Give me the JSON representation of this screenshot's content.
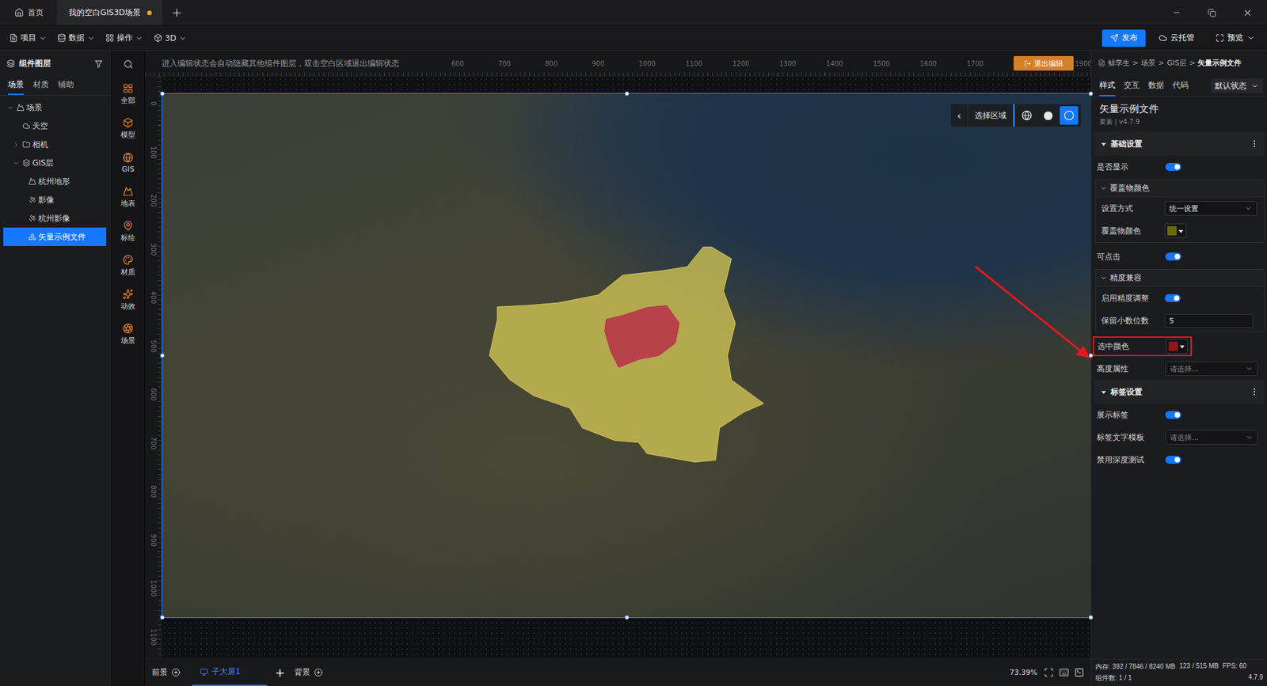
{
  "title_bar": {
    "home": "首页",
    "tabs": [
      {
        "label": "我的空白GIS3D场景",
        "selected": true,
        "unsaved": true
      }
    ],
    "add": "+"
  },
  "menu_bar": {
    "items": [
      {
        "label": "项目",
        "kind": "project"
      },
      {
        "label": "数据",
        "kind": "data"
      },
      {
        "label": "操作",
        "kind": "operate"
      },
      {
        "label": "3D",
        "kind": "model"
      }
    ],
    "actions": [
      {
        "label": "发布",
        "kind": "publish",
        "primary": true
      },
      {
        "label": "云托管",
        "kind": "cloud",
        "primary": false
      },
      {
        "label": "预览",
        "kind": "preview",
        "primary": false
      }
    ]
  },
  "layers_panel": {
    "title": "组件图层",
    "tabs": [
      {
        "label": "场景",
        "selected": true
      },
      {
        "label": "材质",
        "selected": false
      },
      {
        "label": "辅助",
        "selected": false
      }
    ],
    "tree": [
      {
        "label": "场景",
        "kind": "scene",
        "expanded": true,
        "selected": false,
        "children": [
          {
            "label": "天空",
            "kind": "sky",
            "selected": false
          },
          {
            "label": "相机",
            "kind": "folder",
            "expanded": false,
            "selected": false,
            "children": []
          },
          {
            "label": "GIS层",
            "kind": "gis",
            "expanded": true,
            "selected": false,
            "children": [
              {
                "label": "杭州地形",
                "kind": "terrain",
                "selected": false
              },
              {
                "label": "影像",
                "kind": "imagery",
                "selected": false
              },
              {
                "label": "杭州影像",
                "kind": "imagery",
                "selected": false
              },
              {
                "label": "矢量示例文件",
                "kind": "vector",
                "selected": true
              }
            ]
          }
        ]
      }
    ]
  },
  "tool_column": {
    "items": [
      {
        "label": "全部",
        "kind": "all"
      },
      {
        "label": "模型",
        "kind": "model"
      },
      {
        "label": "GIS",
        "kind": "gis"
      },
      {
        "label": "地表",
        "kind": "surface"
      },
      {
        "label": "标绘",
        "kind": "plot"
      },
      {
        "label": "材质",
        "kind": "material"
      },
      {
        "label": "动效",
        "kind": "effect"
      },
      {
        "label": "场景",
        "kind": "scene"
      }
    ]
  },
  "canvas": {
    "hint": "进入编辑状态会自动隐藏其他组件图层，双击空白区域退出编辑状态",
    "ruler_x": [
      "600",
      "700",
      "800",
      "900",
      "1000",
      "1100",
      "1200",
      "1300",
      "1400",
      "1500",
      "1600",
      "1700"
    ],
    "exit": "退出编辑",
    "ruler_x_end": "1900",
    "ruler_y": [
      "0",
      "100",
      "200",
      "300",
      "400",
      "500",
      "600",
      "700",
      "800",
      "900",
      "1000",
      "1100"
    ],
    "map_controls": {
      "back": "‹",
      "label": "选择区域",
      "modes": [
        {
          "kind": "globe",
          "selected": false
        },
        {
          "kind": "solid",
          "selected": false
        },
        {
          "kind": "ring",
          "selected": true
        }
      ]
    },
    "regions": [
      {
        "kind": "district",
        "selected": false,
        "color": "#d8cb55"
      },
      {
        "kind": "core",
        "selected": true,
        "color": "#b8304a"
      }
    ]
  },
  "stage_bar": {
    "foreground": "前景",
    "screens": [
      {
        "label": "子大屏1",
        "selected": true
      }
    ],
    "add": "+",
    "background": "背景",
    "zoom": "73.39%"
  },
  "inspector": {
    "breadcrumb": [
      "鲸孪生",
      "场景",
      "GIS层",
      "矢量示例文件"
    ],
    "separator": ">",
    "tabs": [
      {
        "label": "样式",
        "selected": true
      },
      {
        "label": "交互",
        "selected": false
      },
      {
        "label": "数据",
        "selected": false
      },
      {
        "label": "代码",
        "selected": false
      }
    ],
    "state_select": "默认状态",
    "title": "矢量示例文件",
    "subtitle": "要素 | v4.7.9",
    "sections": [
      {
        "title": "基础设置",
        "expanded": true,
        "rows": [
          {
            "kind": "toggle",
            "label": "是否显示",
            "on": true
          },
          {
            "kind": "group",
            "label": "覆盖物颜色",
            "expanded": true,
            "rows": [
              {
                "kind": "select",
                "label": "设置方式",
                "value": "统一设置",
                "placeholder": false
              },
              {
                "kind": "color",
                "label": "覆盖物颜色",
                "color": "#6b6a12",
                "highlighted": false
              }
            ]
          },
          {
            "kind": "toggle",
            "label": "可点击",
            "on": true
          },
          {
            "kind": "group",
            "label": "精度兼容",
            "expanded": true,
            "rows": [
              {
                "kind": "toggle",
                "label": "启用精度调整",
                "on": true
              },
              {
                "kind": "input",
                "label": "保留小数位数",
                "value": "5"
              }
            ]
          },
          {
            "kind": "color",
            "label": "选中颜色",
            "color": "#8b1a1a",
            "highlighted": true
          },
          {
            "kind": "select",
            "label": "高度属性",
            "value": "请选择...",
            "placeholder": true
          }
        ]
      },
      {
        "title": "标签设置",
        "expanded": true,
        "rows": [
          {
            "kind": "toggle",
            "label": "展示标签",
            "on": true
          },
          {
            "kind": "select",
            "label": "标签文字模板",
            "value": "请选择...",
            "placeholder": true
          },
          {
            "kind": "toggle",
            "label": "禁用深度测试",
            "on": true
          }
        ]
      }
    ]
  },
  "status": {
    "memory": [
      "内存: 392 / 7846 / 8240 MB",
      "123 / 515 MB",
      "FPS: 60"
    ],
    "components": "组件数: 1 / 1",
    "version": "4.7.9"
  }
}
